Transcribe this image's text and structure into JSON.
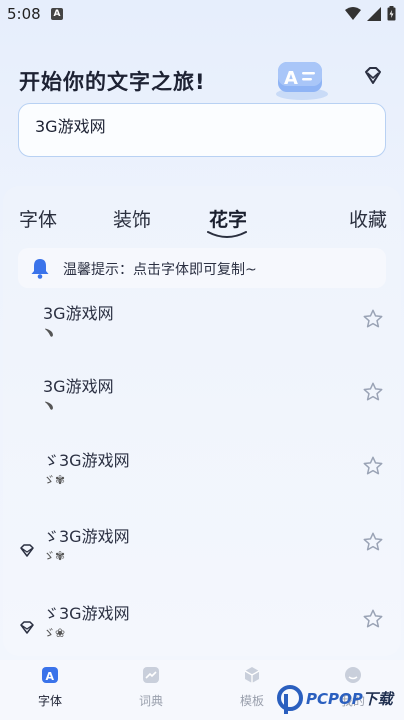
{
  "status_bar": {
    "time": "5:08",
    "notification_icon": "A"
  },
  "header": {
    "title": "开始你的文字之旅!",
    "hero_icon_text": "A"
  },
  "input": {
    "value": "3G游戏网"
  },
  "tabs": [
    {
      "label": "字体"
    },
    {
      "label": "装饰"
    },
    {
      "label": "花字"
    },
    {
      "label": "收藏"
    }
  ],
  "tip": {
    "text": "温馨提示：点击字体即可复制~"
  },
  "items": [
    {
      "name": "3G游戏网",
      "sub": "﹅",
      "has_gem": false
    },
    {
      "name": "3G游戏网",
      "sub": "﹅",
      "has_gem": false
    },
    {
      "name": "ゞ3G游戏网",
      "sub": "ゞ✾",
      "has_gem": false
    },
    {
      "name": "ゞ3G游戏网",
      "sub": "ゞ✾",
      "has_gem": true
    },
    {
      "name": "ゞ3G游戏网",
      "sub": "ゞ❀",
      "has_gem": true
    }
  ],
  "bottom_nav": [
    {
      "label": "字体",
      "icon": "font-icon"
    },
    {
      "label": "词典",
      "icon": "chart-icon"
    },
    {
      "label": "模板",
      "icon": "cube-icon"
    },
    {
      "label": "我的",
      "icon": "profile-icon"
    }
  ],
  "watermark": {
    "brand": "PCPOP",
    "suffix": "下载"
  },
  "colors": {
    "accent": "#3a73ea",
    "tab_underline": "#2a2f3e",
    "border": "#b8d1f3"
  }
}
